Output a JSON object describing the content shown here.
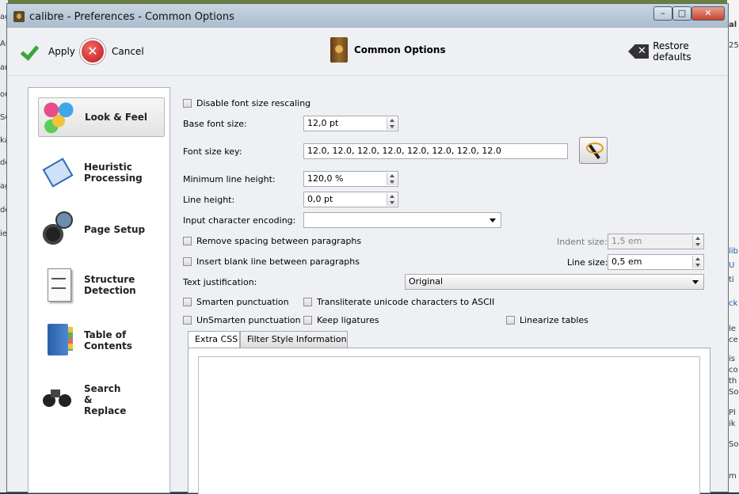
{
  "window": {
    "title": "calibre - Preferences - Common Options",
    "controls": {
      "minimize": "–",
      "maximize": "□",
      "close": "✕"
    }
  },
  "toolbar": {
    "apply_label": "Apply",
    "cancel_label": "Cancel",
    "section_title": "Common Options",
    "restore_label": "Restore defaults"
  },
  "sidebar": {
    "items": [
      {
        "label": "Look & Feel",
        "icon": "paint-palette-icon",
        "selected": true
      },
      {
        "label": "Heuristic\nProcessing",
        "icon": "heuristic-icon"
      },
      {
        "label": "Page Setup",
        "icon": "page-setup-icon"
      },
      {
        "label": "Structure\nDetection",
        "icon": "structure-icon"
      },
      {
        "label": "Table of\nContents",
        "icon": "toc-icon"
      },
      {
        "label": "Search\n&\nReplace",
        "icon": "binoculars-icon"
      }
    ]
  },
  "form": {
    "disable_font_rescaling": "Disable font size rescaling",
    "base_font_size_label": "Base font size:",
    "base_font_size_value": "12,0 pt",
    "font_size_key_label": "Font size key:",
    "font_size_key_value": "12.0, 12.0, 12.0, 12.0, 12.0, 12.0, 12.0, 12.0",
    "min_line_height_label": "Minimum line height:",
    "min_line_height_value": "120,0 %",
    "line_height_label": "Line height:",
    "line_height_value": "0,0 pt",
    "input_encoding_label": "Input character encoding:",
    "input_encoding_value": "",
    "remove_spacing": "Remove spacing between paragraphs",
    "indent_size_label": "Indent size:",
    "indent_size_value": "1,5 em",
    "insert_blank_line": "Insert blank line between paragraphs",
    "line_size_label": "Line size:",
    "line_size_value": "0,5 em",
    "text_justification_label": "Text justification:",
    "text_justification_value": "Original",
    "smarten_punctuation": "Smarten punctuation",
    "transliterate_unicode": "Transliterate unicode characters to ASCII",
    "unsmarten_punctuation": "UnSmarten punctuation",
    "keep_ligatures": "Keep ligatures",
    "linearize_tables": "Linearize tables"
  },
  "tabs": [
    {
      "label": "Extra CSS",
      "active": true
    },
    {
      "label": "Filter Style Information"
    }
  ],
  "background": {
    "left_fragments": [
      "ag",
      "Au",
      "ar",
      "ou",
      "Su",
      "ka",
      "de",
      "ag",
      "de",
      "ie"
    ],
    "right_fragments": [
      "al",
      "25",
      "lib",
      "U",
      "ti",
      "ck",
      "le",
      "ce",
      "is",
      "co",
      "th",
      "So",
      "Pl",
      "ik",
      "So",
      "m"
    ]
  },
  "colors": {
    "accent_green": "#3aa63a",
    "cancel_red": "#c01515"
  }
}
